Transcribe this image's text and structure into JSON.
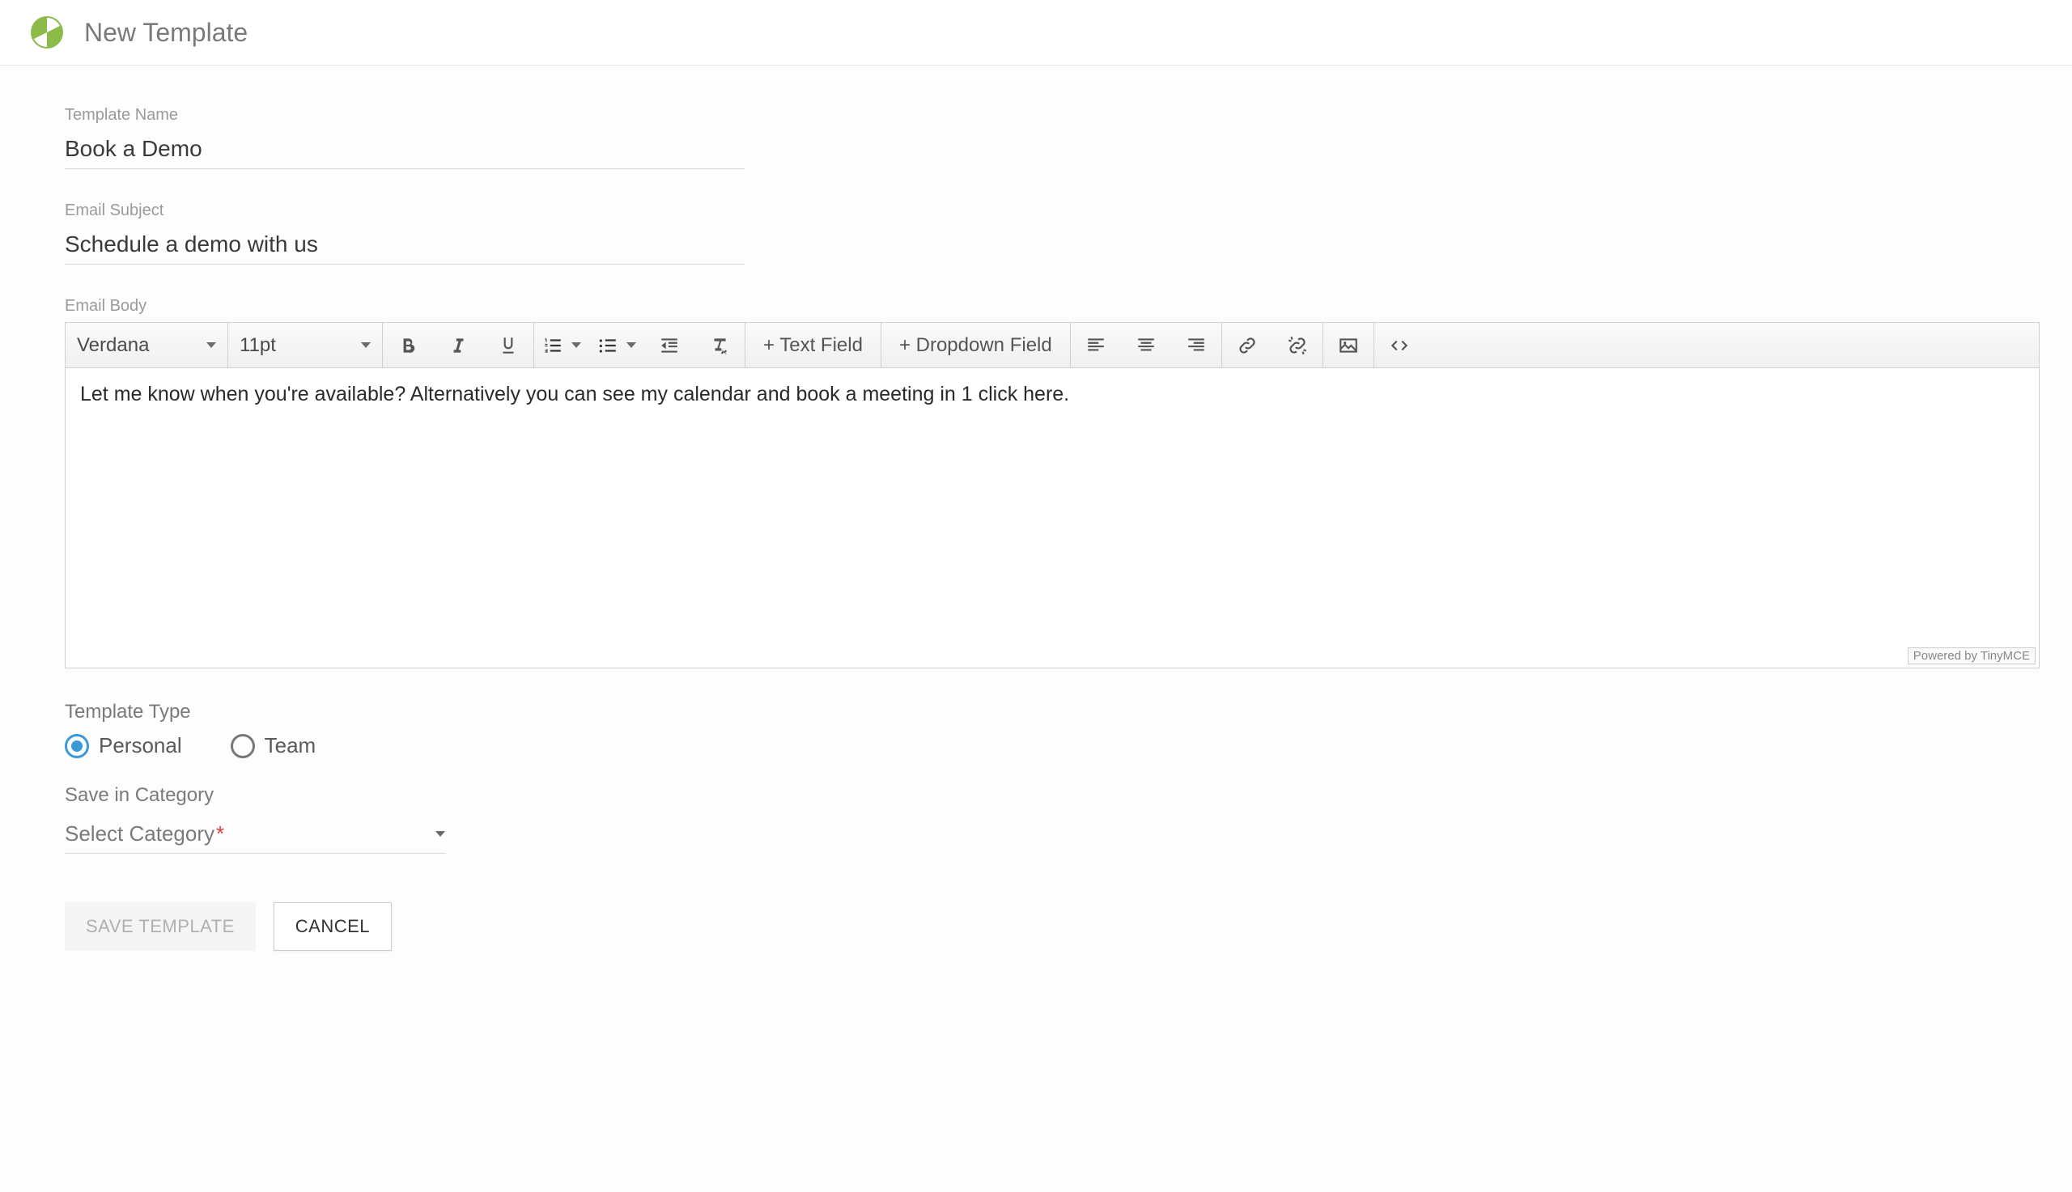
{
  "header": {
    "title": "New Template"
  },
  "fields": {
    "templateName": {
      "label": "Template Name",
      "value": "Book a Demo"
    },
    "emailSubject": {
      "label": "Email Subject",
      "value": "Schedule a demo with us"
    },
    "emailBody": {
      "label": "Email Body"
    }
  },
  "editor": {
    "font": "Verdana",
    "size": "11pt",
    "textFieldBtn": "+ Text Field",
    "dropdownFieldBtn": "+ Dropdown Field",
    "content": "Let me know when you're available? Alternatively you can see my calendar and book a meeting in 1 click here.",
    "poweredBy": "Powered by TinyMCE"
  },
  "templateType": {
    "label": "Template Type",
    "options": {
      "personal": "Personal",
      "team": "Team"
    },
    "selected": "personal"
  },
  "category": {
    "label": "Save in Category",
    "placeholder": "Select Category"
  },
  "actions": {
    "save": "SAVE TEMPLATE",
    "cancel": "CANCEL"
  }
}
